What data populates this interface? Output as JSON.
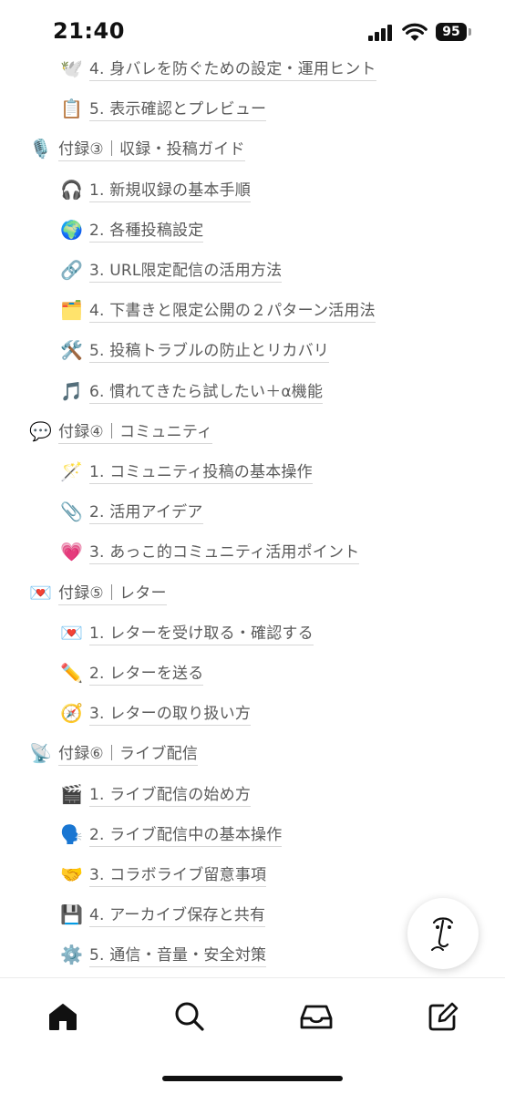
{
  "status": {
    "time": "21:40",
    "battery": "95"
  },
  "toc": [
    {
      "level": "sub",
      "icon": "🕊️",
      "icon_name": "dove-icon",
      "label": "4. 身バレを防ぐための設定・運用ヒント"
    },
    {
      "level": "sub",
      "icon": "📋",
      "icon_name": "clipboard-icon",
      "label": "5. 表示確認とプレビュー"
    },
    {
      "level": "main",
      "icon": "🎙️",
      "icon_name": "microphone-icon",
      "label": "付録③｜収録・投稿ガイド"
    },
    {
      "level": "sub",
      "icon": "🎧",
      "icon_name": "headphones-icon",
      "label": "1. 新規収録の基本手順"
    },
    {
      "level": "sub",
      "icon": "🌍",
      "icon_name": "globe-icon",
      "label": "2. 各種投稿設定"
    },
    {
      "level": "sub",
      "icon": "🔗",
      "icon_name": "link-icon",
      "label": "3. URL限定配信の活用方法"
    },
    {
      "level": "sub",
      "icon": "🗂️",
      "icon_name": "file-box-icon",
      "label": "4. 下書きと限定公開の２パターン活用法"
    },
    {
      "level": "sub",
      "icon": "🛠️",
      "icon_name": "tools-icon",
      "label": "5. 投稿トラブルの防止とリカバリ"
    },
    {
      "level": "sub",
      "icon": "🎵",
      "icon_name": "music-note-icon",
      "label": "6. 慣れてきたら試したい＋α機能"
    },
    {
      "level": "main",
      "icon": "💬",
      "icon_name": "speech-bubble-icon",
      "label": "付録④｜コミュニティ"
    },
    {
      "level": "sub",
      "icon": "🪄",
      "icon_name": "magic-wand-icon",
      "label": "1. コミュニティ投稿の基本操作"
    },
    {
      "level": "sub",
      "icon": "📎",
      "icon_name": "paperclip-icon",
      "label": "2. 活用アイデア"
    },
    {
      "level": "sub",
      "icon": "💗",
      "icon_name": "heart-icon",
      "label": "3. あっこ的コミュニティ活用ポイント"
    },
    {
      "level": "main",
      "icon": "💌",
      "icon_name": "love-letter-icon",
      "label": "付録⑤｜レター"
    },
    {
      "level": "sub",
      "icon": "💌",
      "icon_name": "love-letter-icon",
      "label": "1. レターを受け取る・確認する"
    },
    {
      "level": "sub",
      "icon": "✏️",
      "icon_name": "pencil-icon",
      "label": "2. レターを送る"
    },
    {
      "level": "sub",
      "icon": "🧭",
      "icon_name": "compass-icon",
      "label": "3. レターの取り扱い方"
    },
    {
      "level": "main",
      "icon": "📡",
      "icon_name": "satellite-dish-icon",
      "label": "付録⑥｜ライブ配信"
    },
    {
      "level": "sub",
      "icon": "🎬",
      "icon_name": "clapper-icon",
      "label": "1. ライブ配信の始め方"
    },
    {
      "level": "sub",
      "icon": "🗣️",
      "icon_name": "speaking-head-icon",
      "label": "2. ライブ配信中の基本操作"
    },
    {
      "level": "sub",
      "icon": "🤝",
      "icon_name": "handshake-icon",
      "label": "3. コラボライブ留意事項"
    },
    {
      "level": "sub",
      "icon": "💾",
      "icon_name": "floppy-disk-icon",
      "label": "4. アーカイブ保存と共有"
    },
    {
      "level": "sub",
      "icon": "⚙️",
      "icon_name": "gear-icon",
      "label": "5. 通信・音量・安全対策"
    }
  ],
  "tabs": [
    {
      "icon_name": "home-icon",
      "active": true
    },
    {
      "icon_name": "search-icon",
      "active": false
    },
    {
      "icon_name": "inbox-icon",
      "active": false
    },
    {
      "icon_name": "compose-icon",
      "active": false
    }
  ]
}
